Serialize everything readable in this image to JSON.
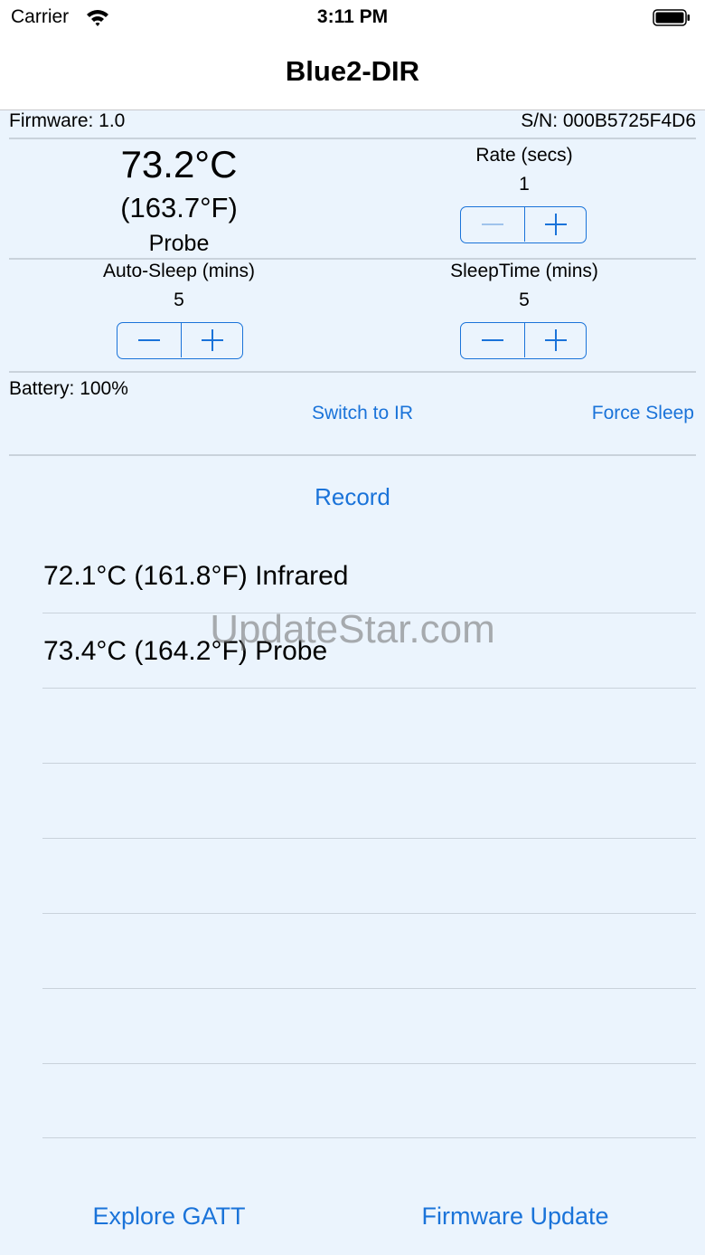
{
  "status_bar": {
    "carrier": "Carrier",
    "time": "3:11 PM"
  },
  "nav": {
    "title": "Blue2-DIR"
  },
  "device": {
    "firmware": "Firmware:  1.0",
    "serial": "S/N:  000B5725F4D6",
    "temp_c": "73.2°C",
    "temp_f": "(163.7°F)",
    "sensor": "Probe",
    "rate_label": "Rate (secs)",
    "rate_value": "1",
    "auto_sleep_label": "Auto-Sleep (mins)",
    "auto_sleep_value": "5",
    "sleep_time_label": "SleepTime (mins)",
    "sleep_time_value": "5",
    "battery": "Battery:  100%"
  },
  "actions": {
    "switch_ir": "Switch to IR",
    "force_sleep": "Force Sleep",
    "record": "Record",
    "explore_gatt": "Explore GATT",
    "firmware_update": "Firmware Update"
  },
  "readings": [
    "72.1°C (161.8°F) Infrared",
    "73.4°C (164.2°F) Probe"
  ],
  "watermark": "UpdateStar.com",
  "colors": {
    "accent": "#1a73d9",
    "background": "#ebf4fd"
  }
}
